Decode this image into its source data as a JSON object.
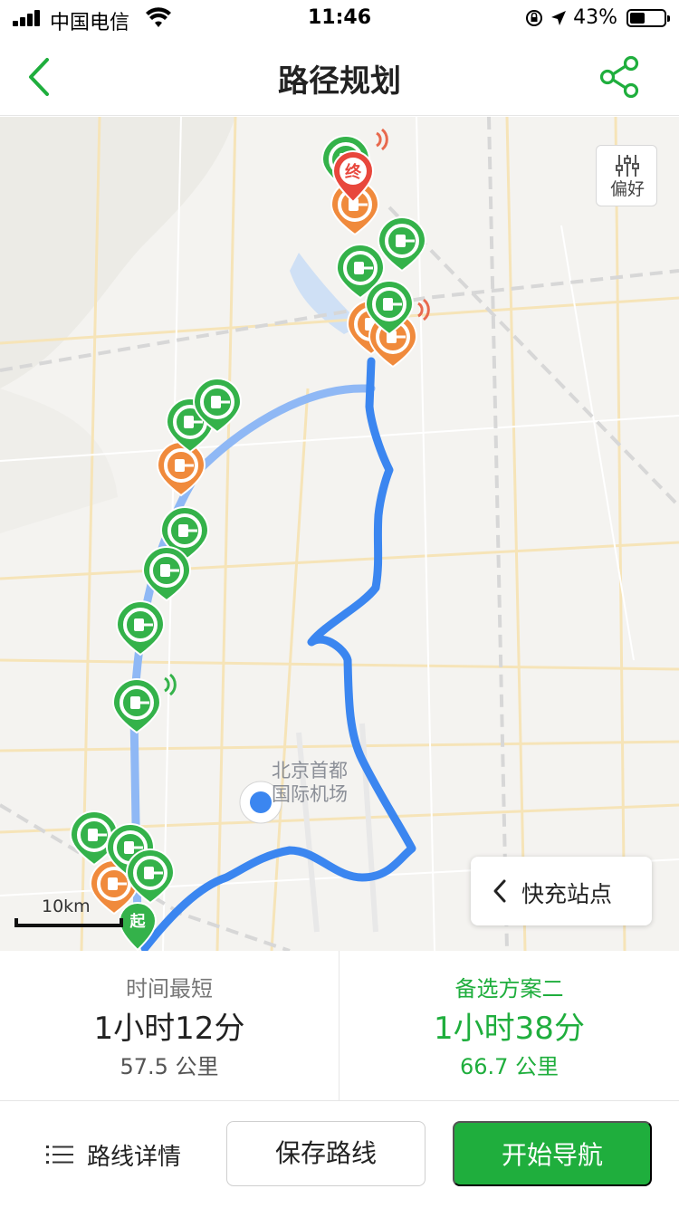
{
  "status_bar": {
    "carrier": "中国电信",
    "time": "11:46",
    "battery_percent": "43%",
    "battery_level": 0.43,
    "icons": [
      "signal-icon",
      "wifi-icon",
      "orientation-lock-icon",
      "location-arrow-icon",
      "battery-icon"
    ]
  },
  "nav": {
    "title": "路径规划",
    "back_icon": "chevron-left-icon",
    "share_icon": "share-icon"
  },
  "colors": {
    "brand_green": "#1fae3d",
    "route_primary": "#3b86f0",
    "route_alt": "#8fb8f5",
    "charger_green": "#34b24a",
    "charger_orange": "#f08a3c",
    "end_marker": "#e8473c"
  },
  "map": {
    "preference_button": {
      "label": "偏好",
      "icon": "sliders-icon"
    },
    "airport_label_line1": "北京首都",
    "airport_label_line2": "国际机场",
    "scale_label": "10km",
    "start_marker_label": "起",
    "end_marker_label": "终",
    "fast_charge_button": {
      "label": "快充站点",
      "icon": "chevron-left-icon"
    }
  },
  "routes": [
    {
      "label": "时间最短",
      "duration": "1小时12分",
      "distance": "57.5 公里"
    },
    {
      "label": "备选方案二",
      "duration": "1小时38分",
      "distance": "66.7 公里"
    }
  ],
  "actions": {
    "details_label": "路线详情",
    "details_icon": "list-icon",
    "save_label": "保存路线",
    "start_label": "开始导航"
  }
}
